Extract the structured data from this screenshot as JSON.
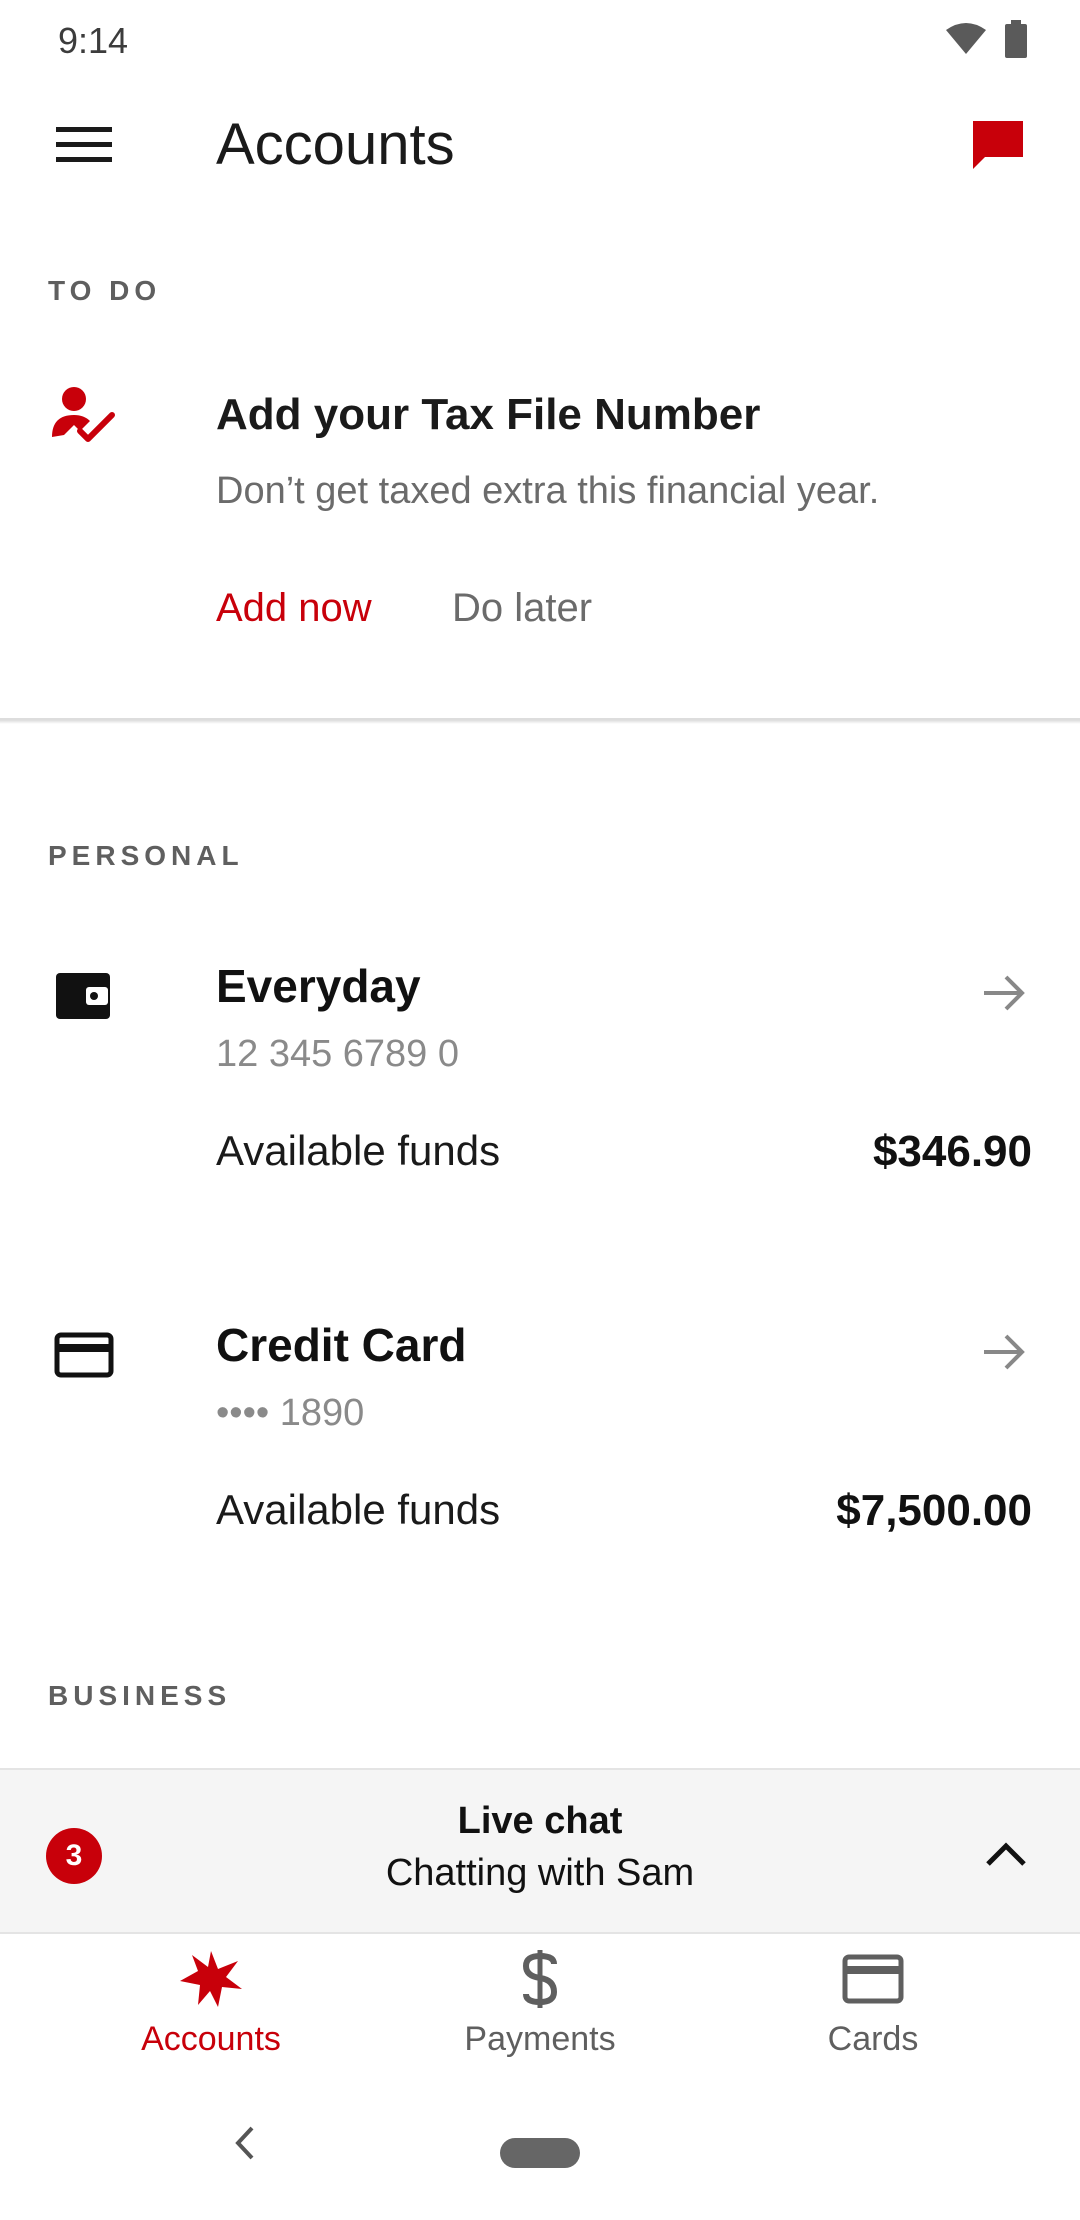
{
  "status_bar": {
    "time": "9:14"
  },
  "app_bar": {
    "title": "Accounts"
  },
  "todo": {
    "section_label": "TO DO",
    "title": "Add your Tax File Number",
    "description": "Don’t get taxed extra this financial year.",
    "primary_action": "Add now",
    "secondary_action": "Do later"
  },
  "personal": {
    "section_label": "PERSONAL",
    "accounts": [
      {
        "name": "Everyday",
        "number": "12 345 6789 0",
        "funds_label": "Available funds",
        "funds_value": "$346.90"
      },
      {
        "name": "Credit Card",
        "number": "•••• 1890",
        "funds_label": "Available funds",
        "funds_value": "$7,500.00"
      }
    ]
  },
  "business": {
    "section_label": "BUSINESS"
  },
  "live_chat": {
    "badge_count": "3",
    "title": "Live chat",
    "subtitle": "Chatting with Sam"
  },
  "bottom_nav": {
    "items": [
      {
        "label": "Accounts",
        "icon": "star-logo-icon",
        "active": true
      },
      {
        "label": "Payments",
        "icon": "dollar-icon",
        "active": false
      },
      {
        "label": "Cards",
        "icon": "card-icon",
        "active": false
      }
    ]
  },
  "colors": {
    "accent": "#c8000a",
    "muted": "#6b6b6b",
    "inactive_nav": "#5f5f5f"
  }
}
